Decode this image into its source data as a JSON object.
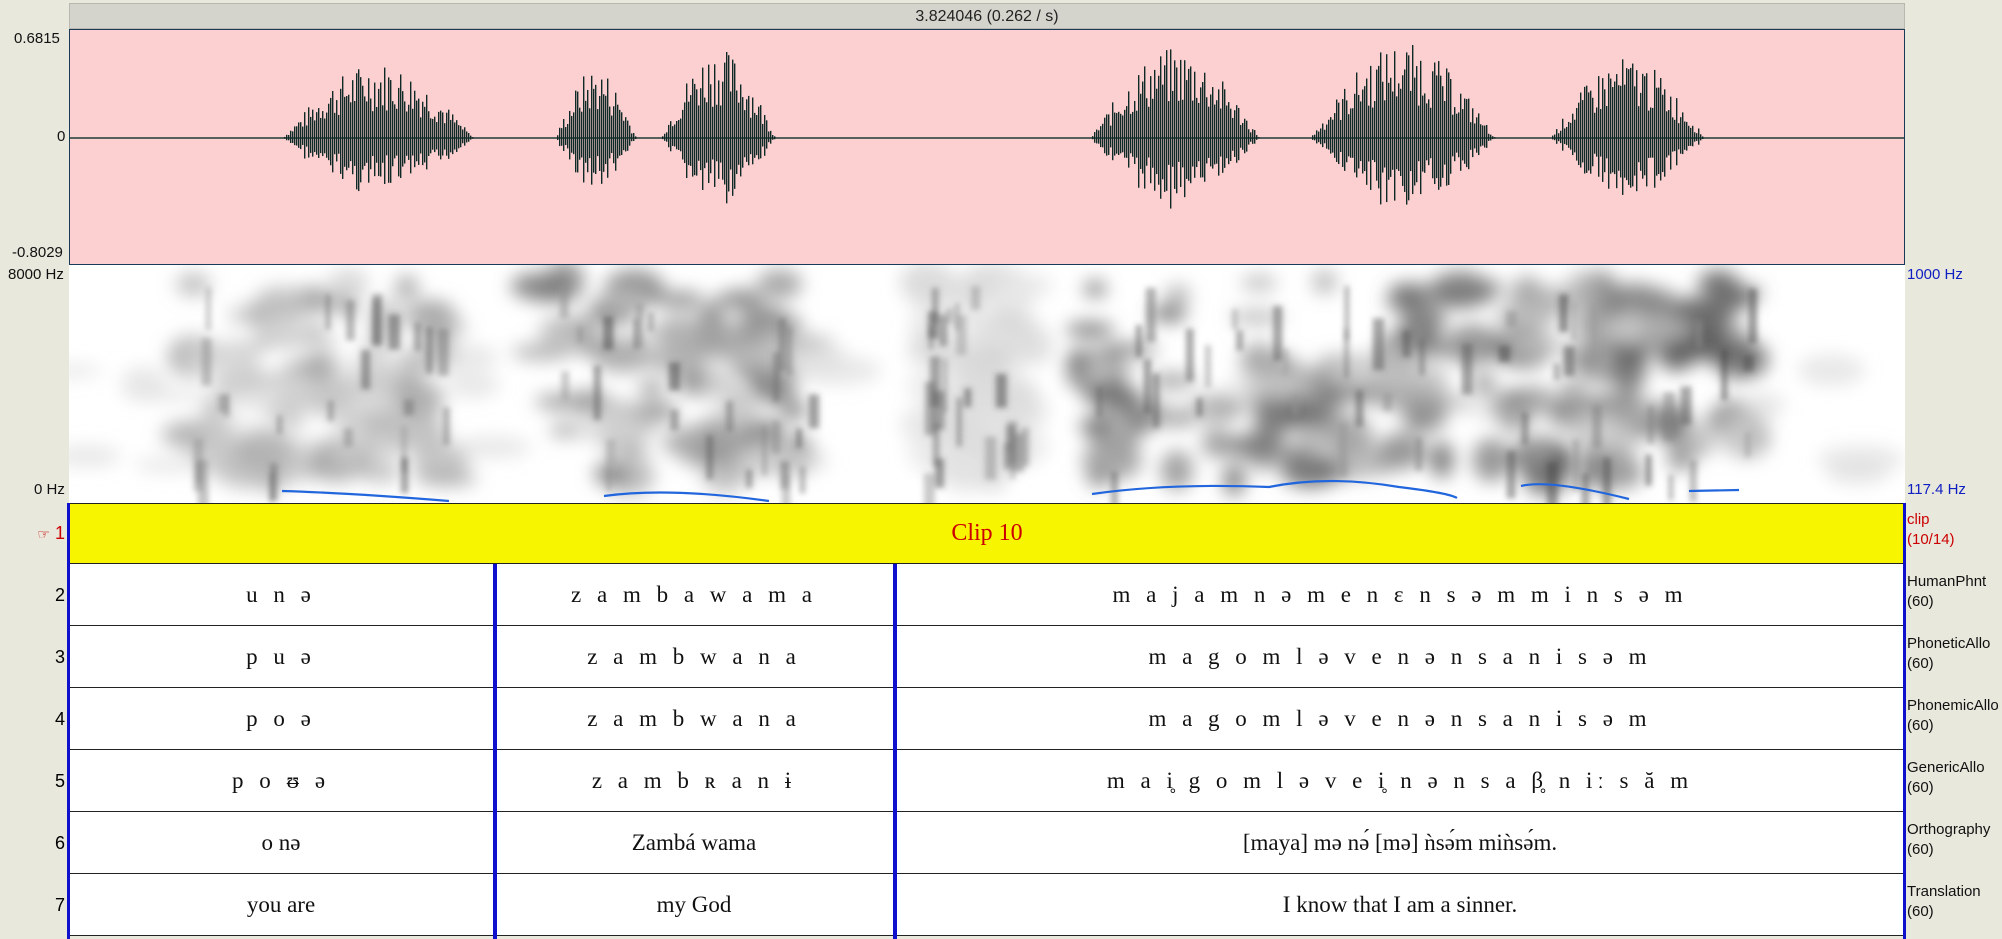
{
  "selection": {
    "readout": "3.824046 (0.262 / s)"
  },
  "waveform": {
    "max_label": "0.6815",
    "zero_label": "0",
    "min_label": "-0.8029"
  },
  "spectrogram": {
    "top_freq_label": "8000 Hz",
    "bottom_freq_label": "0 Hz",
    "pitch_top_label": "1000 Hz",
    "pitch_bottom_label": "117.4 Hz"
  },
  "colors": {
    "clip_bg": "#f8f500",
    "clip_text": "#cc0000",
    "boundary": "#1010cc",
    "pitch": "#2266dd"
  },
  "clip_tier": {
    "number": "1",
    "marker_icon": "arrow-hand-icon",
    "label": "Clip 10",
    "name": "clip",
    "count": "(10/14)"
  },
  "tiers": [
    {
      "number": "2",
      "name": "HumanPhnt",
      "count": "(60)",
      "segments": [
        "u n ə",
        "z a m b a w a m a",
        "m a j a m n ə m e n ɛ n s ə m m i n s ə m"
      ]
    },
    {
      "number": "3",
      "name": "PhoneticAllo",
      "count": "(60)",
      "segments": [
        "p u ə",
        "z a m b w a n a",
        "m a g o m l ə v e n ə n s a n i s ə m"
      ]
    },
    {
      "number": "4",
      "name": "PhonemicAllo",
      "count": "(60)",
      "segments": [
        "p o ə",
        "z a m b w a n a",
        "m a g o m l ə v e n ə n s a n i s ə m"
      ]
    },
    {
      "number": "5",
      "name": "GenericAllo",
      "count": "(60)",
      "segments": [
        "p o ᵿ ə",
        "z a m b ʀ a n ɨ",
        "m a i̥ g o m l ə v e i̥ n ə n s a β̥ n iː s ă m"
      ]
    },
    {
      "number": "6",
      "name": "Orthography",
      "count": "(60)",
      "segments": [
        "o nə",
        "Zambá wama",
        "[maya] mə nə́ [mə] ǹsə́m miǹsə́m."
      ]
    },
    {
      "number": "7",
      "name": "Translation",
      "count": "(60)",
      "segments": [
        "you are",
        "my God",
        "I know that I am a sinner."
      ]
    }
  ]
}
